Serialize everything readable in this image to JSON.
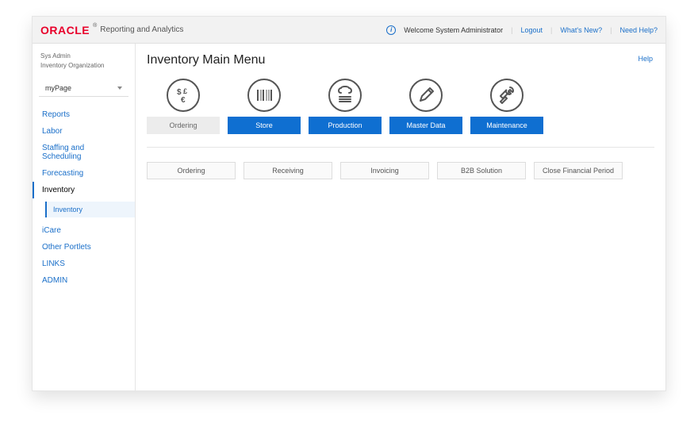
{
  "header": {
    "brand": "ORACLE",
    "product": "Reporting and Analytics",
    "welcome": "Welcome System Administrator",
    "links": {
      "logout": "Logout",
      "whatsnew": "What's New?",
      "needhelp": "Need Help?"
    }
  },
  "sidebar": {
    "context_line1": "Sys Admin",
    "context_line2": "Inventory Organization",
    "dropdown": "myPage",
    "nav": [
      {
        "label": "Reports",
        "active": false
      },
      {
        "label": "Labor",
        "active": false
      },
      {
        "label": "Staffing and Scheduling",
        "active": false
      },
      {
        "label": "Forecasting",
        "active": false
      },
      {
        "label": "Inventory",
        "active": true,
        "sub": [
          "Inventory"
        ]
      },
      {
        "label": "iCare",
        "active": false
      },
      {
        "label": "Other Portlets",
        "active": false
      },
      {
        "label": "LINKS",
        "active": false
      },
      {
        "label": "ADMIN",
        "active": false
      }
    ]
  },
  "main": {
    "title": "Inventory Main Menu",
    "help": "Help",
    "tiles": [
      {
        "label": "Ordering",
        "style": "muted",
        "icon": "currency"
      },
      {
        "label": "Store",
        "style": "primary",
        "icon": "barcode"
      },
      {
        "label": "Production",
        "style": "primary",
        "icon": "chef"
      },
      {
        "label": "Master Data",
        "style": "primary",
        "icon": "pencil"
      },
      {
        "label": "Maintenance",
        "style": "primary",
        "icon": "wrench"
      }
    ],
    "actions": [
      "Ordering",
      "Receiving",
      "Invoicing",
      "B2B Solution",
      "Close Financial Period"
    ]
  }
}
